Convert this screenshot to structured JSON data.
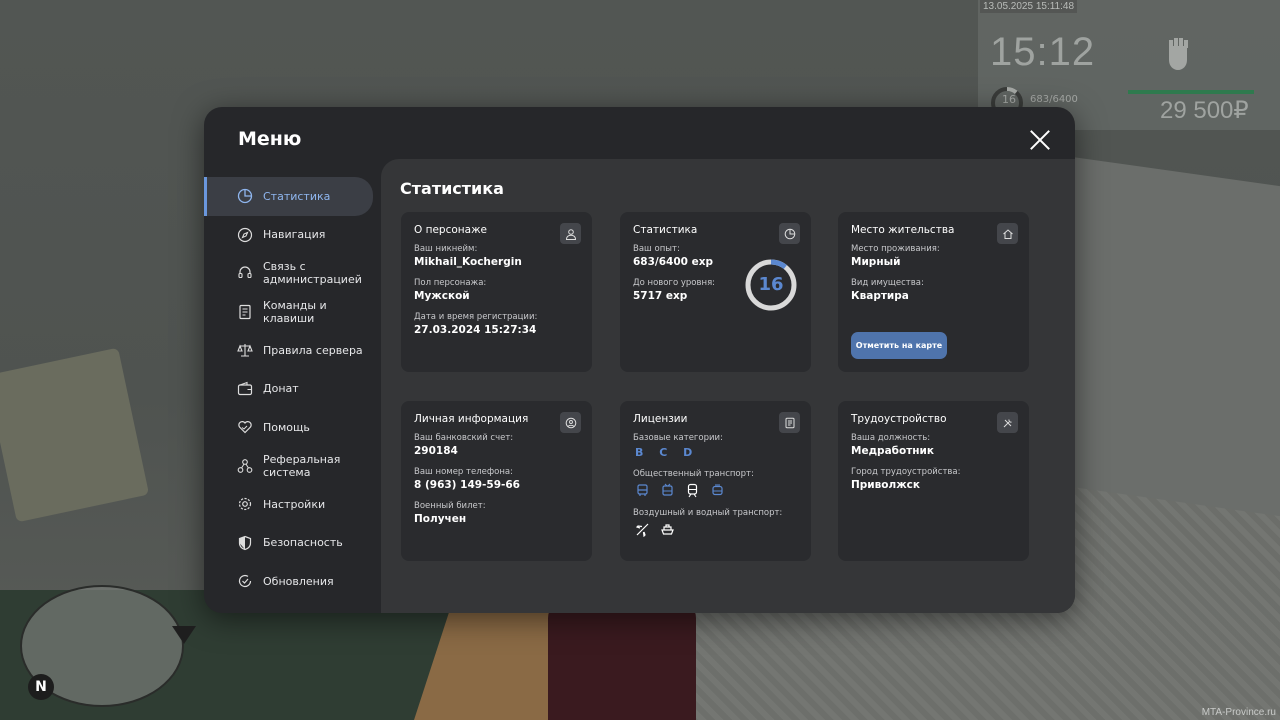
{
  "hud": {
    "timestamp": "13.05.2025 15:11:48",
    "time": "15:12",
    "level": "16",
    "exp": "683/6400",
    "money": "29 500₽",
    "watermark": "MTA-Province.ru"
  },
  "minimap": {
    "north": "N"
  },
  "menu": {
    "title": "Меню",
    "sidebar": [
      {
        "label": "Статистика",
        "icon": "pie-chart-icon",
        "active": true
      },
      {
        "label": "Навигация",
        "icon": "compass-icon"
      },
      {
        "label": "Связь с администрацией",
        "icon": "headset-icon"
      },
      {
        "label": "Команды и клавиши",
        "icon": "document-icon"
      },
      {
        "label": "Правила сервера",
        "icon": "scales-icon"
      },
      {
        "label": "Донат",
        "icon": "wallet-icon"
      },
      {
        "label": "Помощь",
        "icon": "heart-hands-icon"
      },
      {
        "label": "Реферальная система",
        "icon": "network-icon"
      },
      {
        "label": "Настройки",
        "icon": "gear-icon"
      },
      {
        "label": "Безопасность",
        "icon": "shield-icon"
      },
      {
        "label": "Обновления",
        "icon": "refresh-check-icon"
      }
    ],
    "content_title": "Статистика",
    "cards": {
      "character": {
        "title": "О персонаже",
        "nickname_label": "Ваш никнейм:",
        "nickname": "Mikhail_Kochergin",
        "gender_label": "Пол персонажа:",
        "gender": "Мужской",
        "reg_label": "Дата и время регистрации:",
        "reg": "27.03.2024 15:27:34"
      },
      "stats": {
        "title": "Статистика",
        "exp_label": "Ваш опыт:",
        "exp": "683/6400 exp",
        "next_label": "До нового уровня:",
        "next": "5717 exp",
        "level": "16",
        "progress": 0.107
      },
      "residence": {
        "title": "Место жительства",
        "place_label": "Место проживания:",
        "place": "Мирный",
        "type_label": "Вид имущества:",
        "type": "Квартира",
        "button": "Отметить на карте"
      },
      "personal": {
        "title": "Личная информация",
        "bank_label": "Ваш банковский счет:",
        "bank": "290184",
        "phone_label": "Ваш номер телефона:",
        "phone": "8 (963) 149-59-66",
        "military_label": "Военный билет:",
        "military": "Получен"
      },
      "licenses": {
        "title": "Лицензии",
        "base_label": "Базовые категории:",
        "categories": "B C D",
        "public_label": "Общественный транспорт:",
        "air_label": "Воздушный и водный транспорт:"
      },
      "job": {
        "title": "Трудоустройство",
        "position_label": "Ваша должность:",
        "position": "Медработник",
        "city_label": "Город трудоустройства:",
        "city": "Приволжск"
      }
    }
  }
}
